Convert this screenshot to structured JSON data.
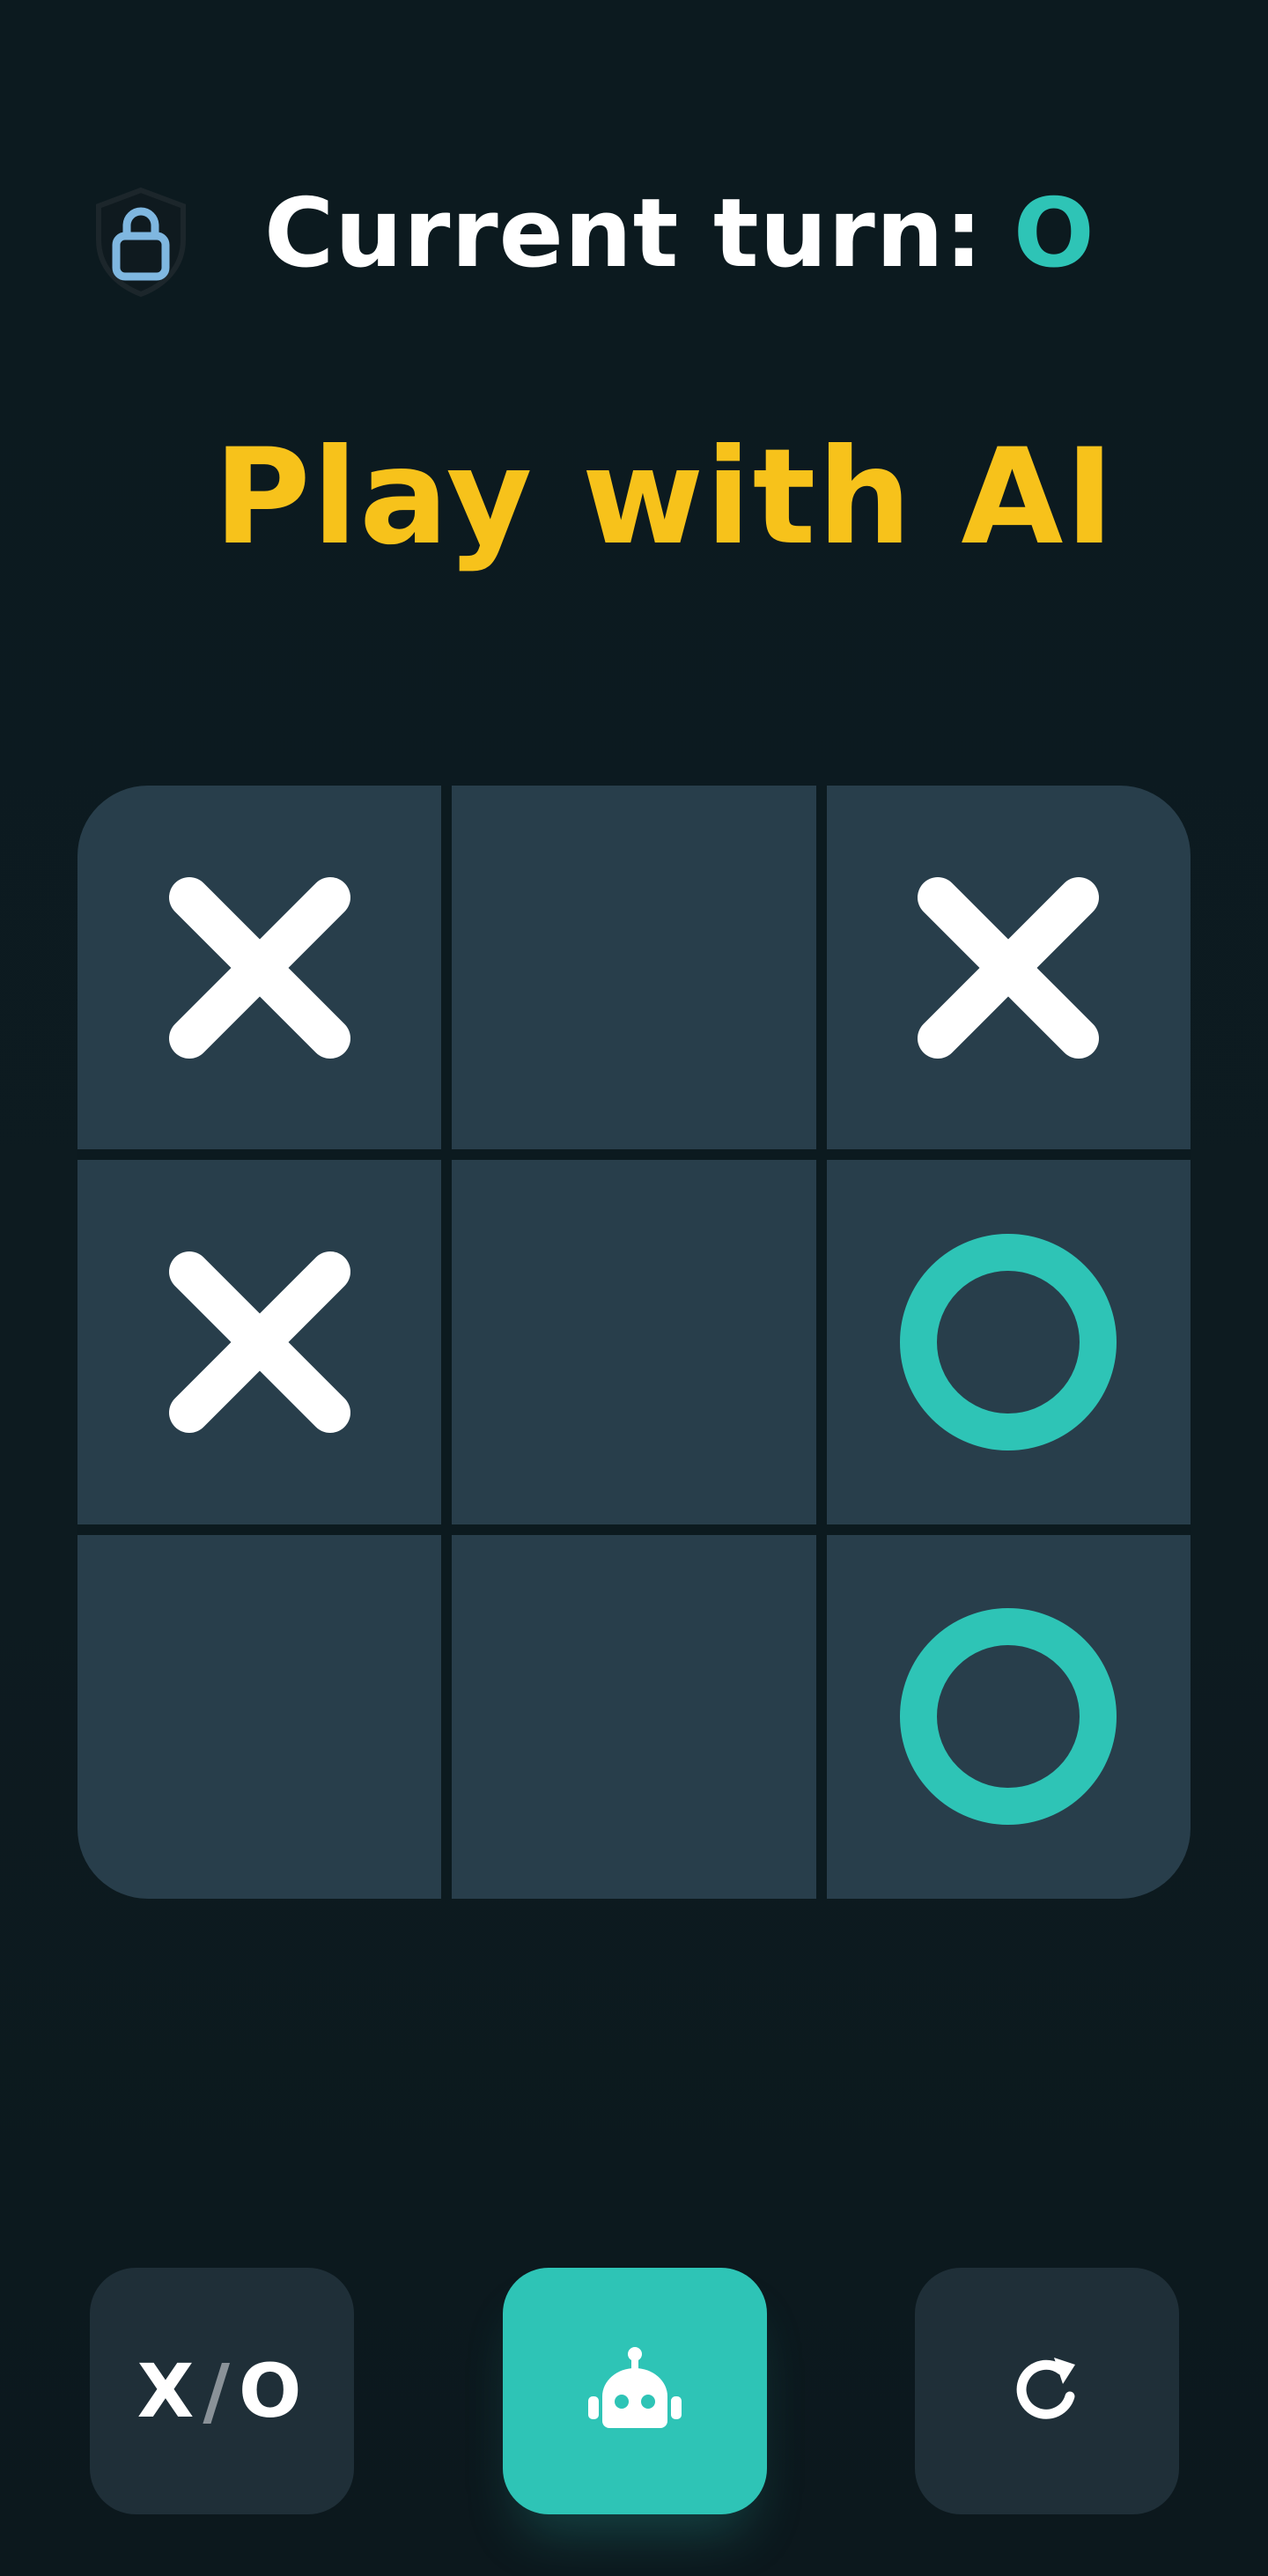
{
  "header": {
    "turn_label": "Current turn:",
    "turn_value": "O",
    "lock_icon": "lock-shield-icon"
  },
  "mode_title": "Play with AI",
  "board": {
    "cells": [
      "X",
      "",
      "X",
      "X",
      "",
      "O",
      "",
      "",
      "O"
    ]
  },
  "colors": {
    "background": "#0c1a1f",
    "cell": "#283e4b",
    "x_mark": "#ffffff",
    "o_mark": "#2ec4b6",
    "title": "#f7c21b",
    "accent": "#2ec4b6",
    "button": "#1f2f38"
  },
  "controls": {
    "mode_toggle": {
      "x": "X",
      "slash": "/",
      "o": "O"
    },
    "ai_button_icon": "robot-icon",
    "restart_icon": "restart-icon"
  }
}
